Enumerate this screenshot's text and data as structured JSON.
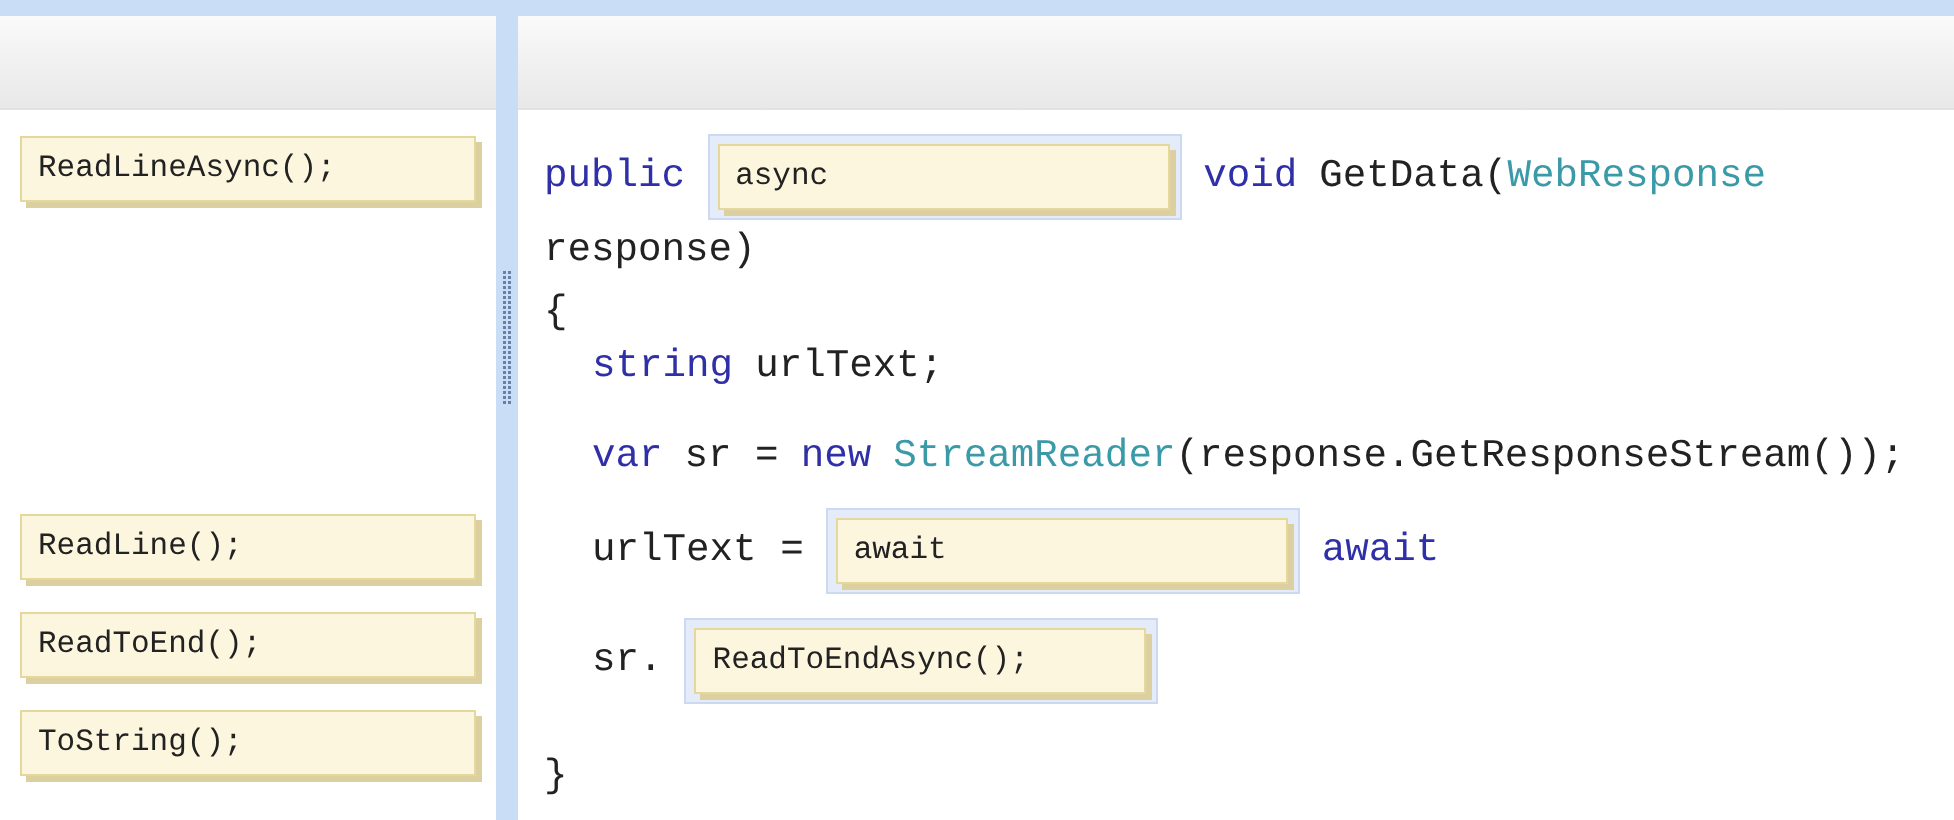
{
  "answer_choices": [
    {
      "text": "ReadLineAsync();"
    },
    {
      "text": "ReadLine();"
    },
    {
      "text": "ReadToEnd();"
    },
    {
      "text": "ToString();"
    }
  ],
  "code_lines": [
    {
      "indented": false,
      "tokens": [
        {
          "kind": "keyword",
          "text": "public"
        },
        {
          "kind": "drop",
          "text": "async"
        },
        {
          "kind": "keyword",
          "text": "void"
        },
        {
          "kind": "plain",
          "text": "GetData("
        },
        {
          "kind": "type",
          "text": "WebResponse"
        }
      ]
    },
    {
      "indented": false,
      "tokens": [
        {
          "kind": "plain",
          "text": "response)"
        }
      ]
    },
    {
      "indented": false,
      "tokens": [
        {
          "kind": "plain",
          "text": "{"
        }
      ]
    },
    {
      "indented": true,
      "tokens": [
        {
          "kind": "keyword",
          "text": "string"
        },
        {
          "kind": "plain",
          "text": "urlText;"
        }
      ]
    },
    {
      "indented": true,
      "tokens": [
        {
          "kind": "keyword",
          "text": "var"
        },
        {
          "kind": "plain",
          "text": "sr ="
        },
        {
          "kind": "keyword",
          "text": "new"
        },
        {
          "kind": "type",
          "text": "StreamReader"
        },
        {
          "kind": "plain",
          "text": "(response.GetResponseStream());"
        }
      ]
    },
    {
      "indented": true,
      "tokens": [
        {
          "kind": "plain",
          "text": "urlText ="
        },
        {
          "kind": "drop",
          "text": "await"
        },
        {
          "kind": "keyword",
          "text": "await"
        }
      ]
    },
    {
      "indented": true,
      "tokens": [
        {
          "kind": "plain",
          "text": "sr."
        },
        {
          "kind": "drop",
          "text": "ReadToEndAsync();"
        }
      ]
    },
    {
      "indented": false,
      "tokens": [
        {
          "kind": "plain",
          "text": "}"
        }
      ]
    }
  ]
}
